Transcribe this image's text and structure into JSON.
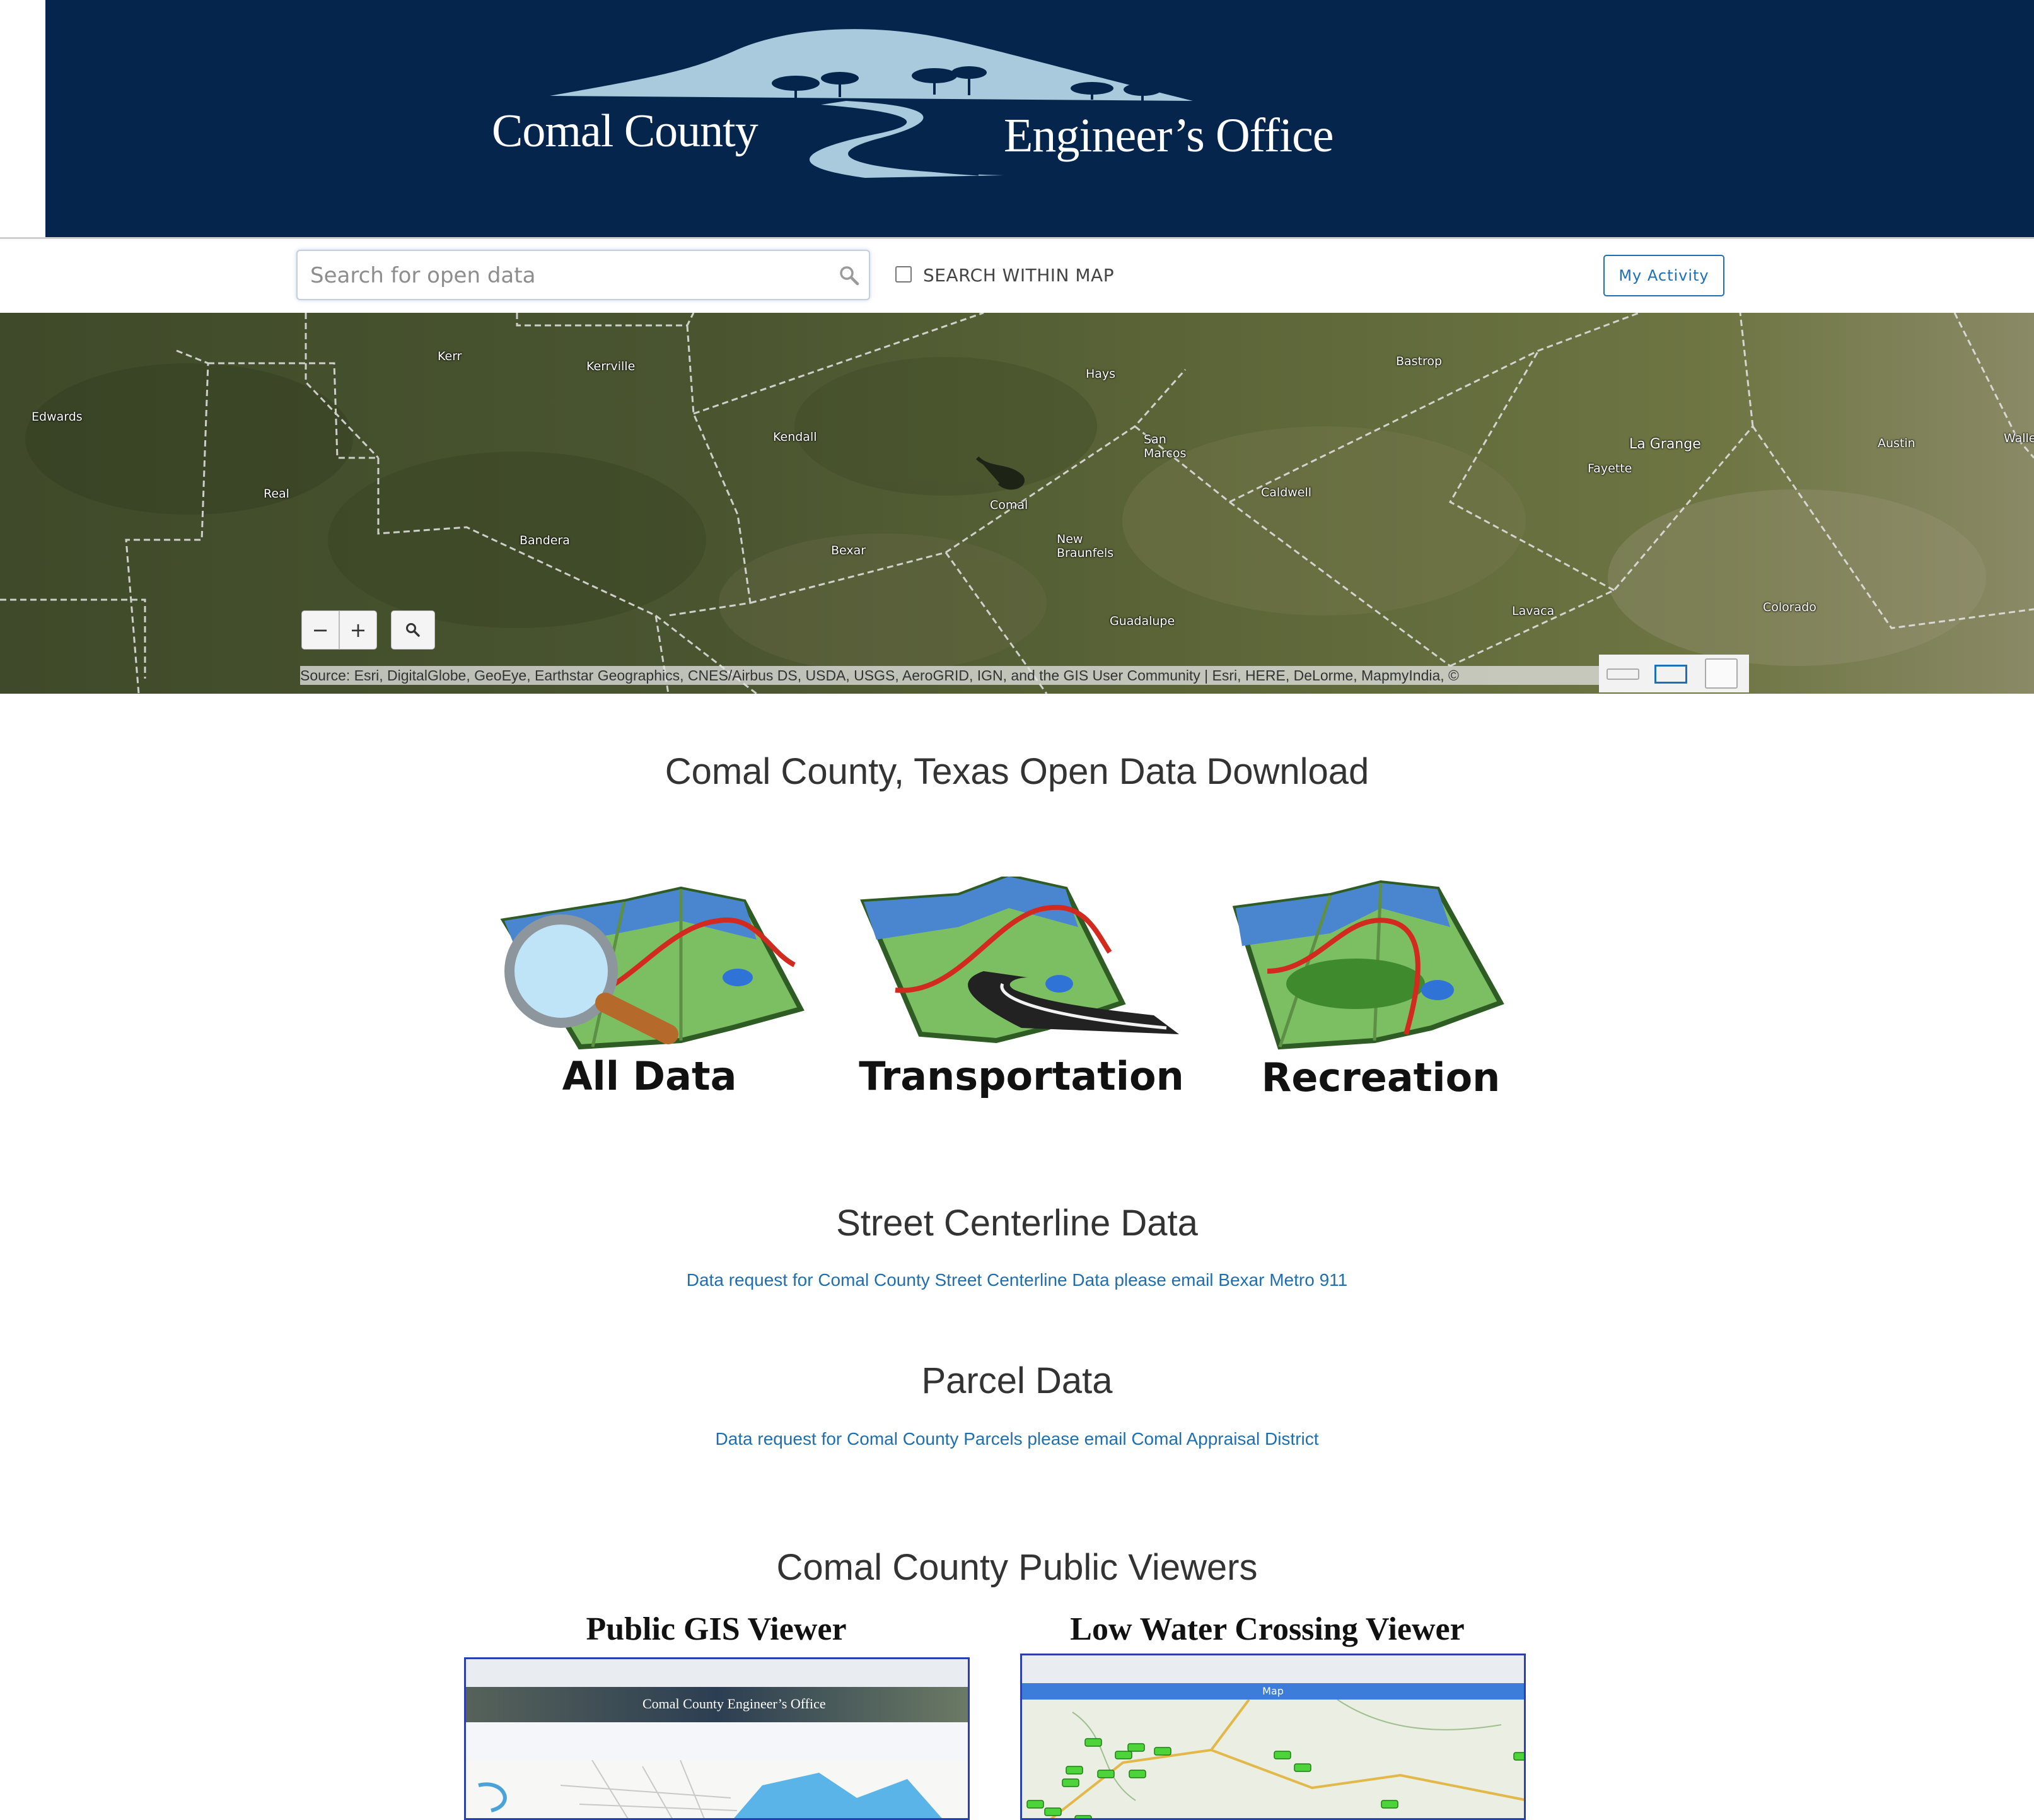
{
  "header": {
    "logo_left": "Comal County",
    "logo_right": "Engineer’s Office"
  },
  "toolbar": {
    "search_placeholder": "Search for open data",
    "search_within_map_label": "SEARCH WITHIN MAP",
    "my_activity_label": "My Activity"
  },
  "map": {
    "places": [
      "Edwards",
      "Kerr",
      "Kerrville",
      "Real",
      "Bandera",
      "Kendall",
      "Bexar",
      "Comal",
      "Hays",
      "San Marcos",
      "New Braunfels",
      "Guadalupe",
      "Caldwell",
      "Bastrop",
      "La Grange",
      "Fayette",
      "Lavaca",
      "Colorado",
      "Austin",
      "Walle"
    ],
    "zoom_out_label": "−",
    "zoom_in_label": "+",
    "attribution": "Source: Esri, DigitalGlobe, GeoEye, Earthstar Geographics, CNES/Airbus DS, USDA, USGS, AeroGRID, IGN, and the GIS User Community | Esri, HERE, DeLorme, MapmyIndia, ©"
  },
  "main": {
    "title": "Comal County, Texas Open Data Download",
    "categories": [
      {
        "label": "All Data",
        "icon": "map-magnifier-icon"
      },
      {
        "label": "Transportation",
        "icon": "map-road-icon"
      },
      {
        "label": "Recreation",
        "icon": "map-icon"
      }
    ],
    "street": {
      "title": "Street Centerline Data",
      "link": "Data request for Comal County Street Centerline Data please email Bexar Metro 911"
    },
    "parcel": {
      "title": "Parcel Data",
      "link": "Data request for Comal County Parcels please email Comal Appraisal District"
    },
    "viewers": {
      "title": "Comal County Public Viewers",
      "items": [
        {
          "label": "Public GIS Viewer",
          "inner_title": "Comal County Engineer’s Office"
        },
        {
          "label": "Low Water Crossing Viewer",
          "inner_title": "Map"
        }
      ]
    }
  },
  "colors": {
    "banner": "#06254d",
    "logo_accent": "#a9c9dc",
    "link": "#1f6fb0"
  }
}
